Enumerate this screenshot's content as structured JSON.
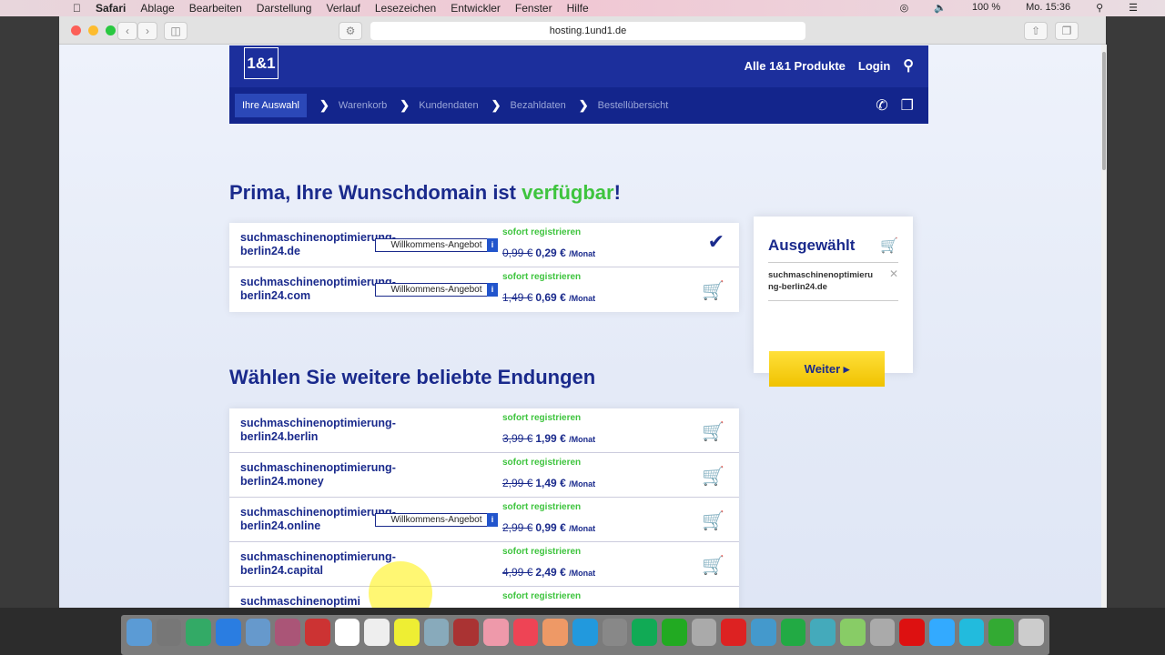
{
  "menubar": {
    "apple": "",
    "app": "Safari",
    "items": [
      "Ablage",
      "Bearbeiten",
      "Darstellung",
      "Verlauf",
      "Lesezeichen",
      "Entwickler",
      "Fenster",
      "Hilfe"
    ],
    "battery": "100 %",
    "clock": "Mo. 15:36"
  },
  "browser": {
    "url": "hosting.1und1.de"
  },
  "site": {
    "logo": "1&1",
    "header_links": [
      "Alle 1&1 Produkte",
      "Login"
    ],
    "steps": [
      "Ihre Auswahl",
      "Warenkorb",
      "Kundendaten",
      "Bezahldaten",
      "Bestellübersicht"
    ],
    "headline_pre": "Prima, Ihre Wunschdomain ist ",
    "headline_green": "verfügbar",
    "headline_post": "!",
    "primary": [
      {
        "domain": "suchmaschinenoptimierung-berlin24.de",
        "offer": "Willkommens-Angebot",
        "status": "sofort registrieren",
        "old": "0,99 €",
        "new": "0,29 €",
        "unit": "/Monat",
        "selected": true
      },
      {
        "domain": "suchmaschinenoptimierung-berlin24.com",
        "offer": "Willkommens-Angebot",
        "status": "sofort registrieren",
        "old": "1,49 €",
        "new": "0,69 €",
        "unit": "/Monat",
        "selected": false
      }
    ],
    "more_title": "Wählen Sie weitere beliebte Endungen",
    "more": [
      {
        "domain": "suchmaschinenoptimierung-berlin24.berlin",
        "status": "sofort registrieren",
        "old": "3,99 €",
        "new": "1,99 €",
        "unit": "/Monat"
      },
      {
        "domain": "suchmaschinenoptimierung-berlin24.money",
        "status": "sofort registrieren",
        "old": "2,99 €",
        "new": "1,49 €",
        "unit": "/Monat"
      },
      {
        "domain": "suchmaschinenoptimierung-berlin24.online",
        "offer": "Willkommens-Angebot",
        "status": "sofort registrieren",
        "old": "2,99 €",
        "new": "0,99 €",
        "unit": "/Monat"
      },
      {
        "domain": "suchmaschinenoptimierung-berlin24.capital",
        "status": "sofort registrieren",
        "old": "4,99 €",
        "new": "2,49 €",
        "unit": "/Monat"
      },
      {
        "domain": "suchmaschinenoptimi",
        "status": "sofort registrieren"
      }
    ],
    "sidebar": {
      "title": "Ausgewählt",
      "item": "suchmaschinenoptimierung-berlin24.de",
      "button": "Weiter"
    }
  }
}
